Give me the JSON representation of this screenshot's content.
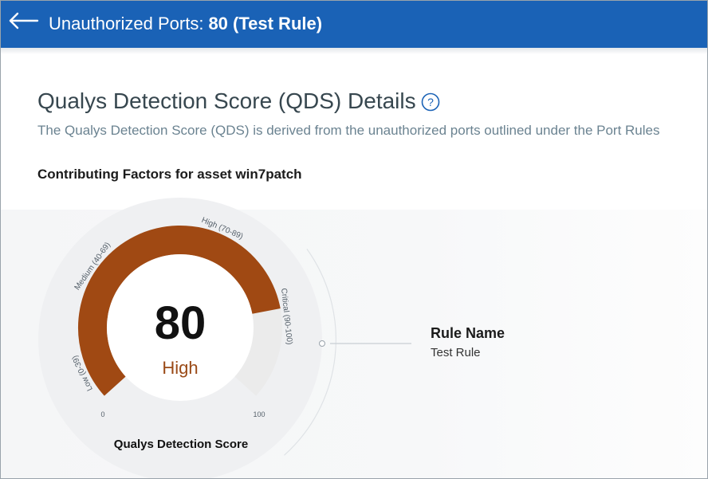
{
  "header": {
    "title_prefix": "Unauthorized Ports:",
    "title_rule": "80 (Test Rule)"
  },
  "page": {
    "title": "Qualys Detection Score (QDS) Details",
    "description": "The Qualys Detection Score (QDS) is derived from the unauthorized ports outlined under the Port Rules",
    "section_title": "Contributing Factors for asset win7patch"
  },
  "gauge": {
    "score": "80",
    "level": "High",
    "label": "Qualys Detection Score",
    "min_label": "0",
    "max_label": "100",
    "value_fraction": 0.8,
    "fill_color": "#a04913",
    "track_color": "#ebebeb",
    "bands": [
      {
        "label": "Low (0-39)"
      },
      {
        "label": "Medium (40-69)"
      },
      {
        "label": "High (70-89)"
      },
      {
        "label": "Critical (90-100)"
      }
    ]
  },
  "rule": {
    "name_label": "Rule Name",
    "name_value": "Test Rule"
  },
  "icons": {
    "back": "arrow-left-icon",
    "help": "help-circle-icon"
  },
  "colors": {
    "header_bg": "#1a62b6",
    "accent_level": "#9a4a17"
  }
}
